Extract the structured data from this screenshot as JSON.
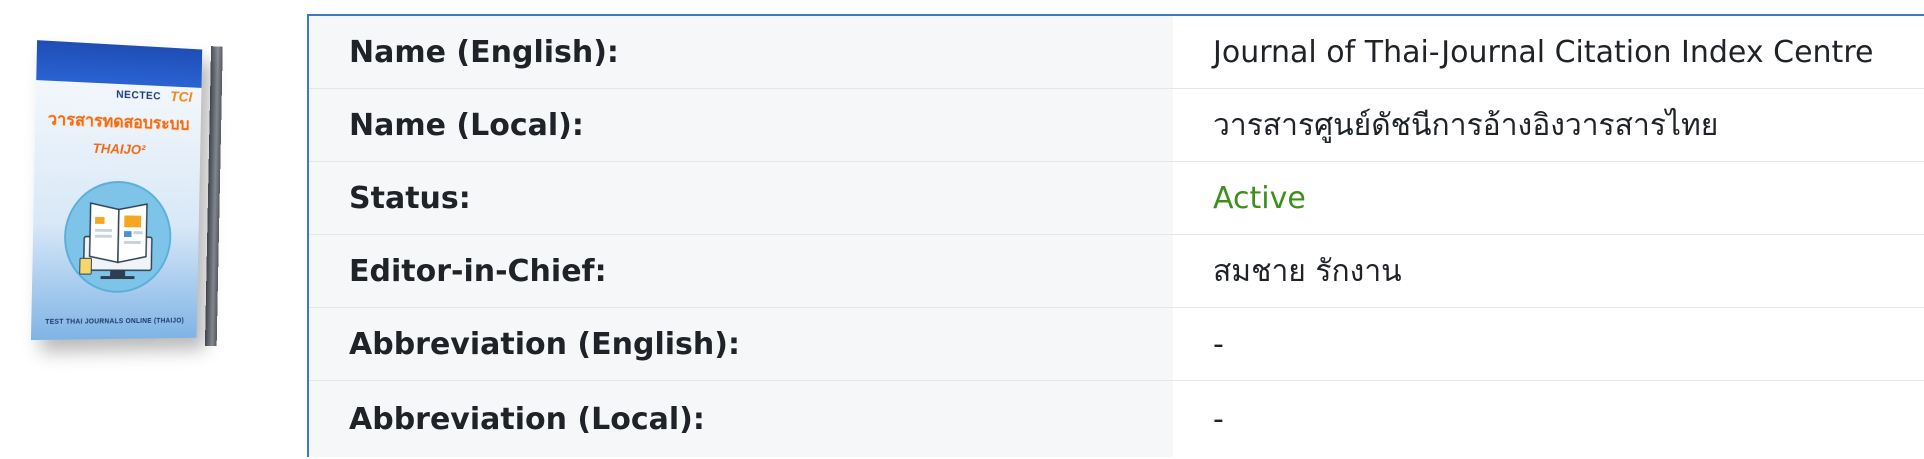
{
  "cover": {
    "logo_left": "NECTEC",
    "logo_right": "TCI",
    "title": "วารสารทดสอบระบบ",
    "subtitle": "THAIJO²",
    "footer": "TEST THAI JOURNALS ONLINE (THAIJO)"
  },
  "rows": [
    {
      "label": "Name (English):",
      "value": "Journal of Thai-Journal Citation Index Centre"
    },
    {
      "label": "Name (Local):",
      "value": "วารสารศูนย์ดัชนีการอ้างอิงวารสารไทย"
    },
    {
      "label": "Status:",
      "value": "Active"
    },
    {
      "label": "Editor-in-Chief:",
      "value": "สมชาย รักงาน"
    },
    {
      "label": "Abbreviation (English):",
      "value": "-"
    },
    {
      "label": "Abbreviation (Local):",
      "value": "-"
    }
  ],
  "colors": {
    "table_border": "#3a7bc8",
    "status_active": "#3f8f1f",
    "label_bg": "#f6f7f9"
  }
}
